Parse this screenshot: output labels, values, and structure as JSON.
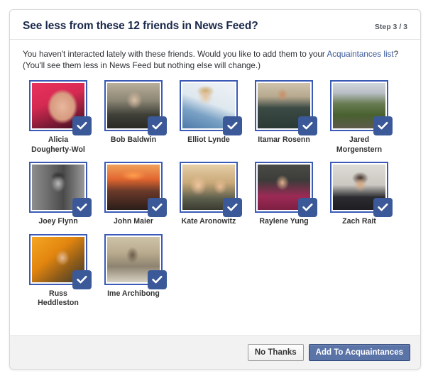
{
  "dialog": {
    "title": "See less from these 12 friends in News Feed?",
    "step": "Step 3 / 3",
    "intro_before": "You haven't interacted lately with these friends. Would you like to add them to your ",
    "intro_link": "Acquaintances list",
    "intro_after": "? (You'll see them less in News Feed but nothing else will change.)"
  },
  "friends": [
    {
      "name": "Alicia Dougherty-Wol",
      "selected": true,
      "photo": "ph-alicia"
    },
    {
      "name": "Bob Baldwin",
      "selected": true,
      "photo": "ph-bob"
    },
    {
      "name": "Elliot Lynde",
      "selected": true,
      "photo": "ph-elliot"
    },
    {
      "name": "Itamar Rosenn",
      "selected": true,
      "photo": "ph-itamar"
    },
    {
      "name": "Jared Morgenstern",
      "selected": true,
      "photo": "ph-jared"
    },
    {
      "name": "Joey Flynn",
      "selected": true,
      "photo": "ph-joey"
    },
    {
      "name": "John Maier",
      "selected": true,
      "photo": "ph-john"
    },
    {
      "name": "Kate Aronowitz",
      "selected": true,
      "photo": "ph-kate"
    },
    {
      "name": "Raylene Yung",
      "selected": true,
      "photo": "ph-raylene"
    },
    {
      "name": "Zach Rait",
      "selected": true,
      "photo": "ph-zach"
    },
    {
      "name": "Russ Heddleston",
      "selected": true,
      "photo": "ph-russ"
    },
    {
      "name": "Ime Archibong",
      "selected": true,
      "photo": "ph-ime"
    }
  ],
  "footer": {
    "secondary_label": "No Thanks",
    "primary_label": "Add To Acquaintances"
  },
  "icons": {
    "check": "check-icon"
  },
  "colors": {
    "brand_blue": "#3b5998",
    "primary_button": "#5b74a8",
    "tile_border": "#3b5ab5",
    "link": "#3b5998",
    "title": "#1b2a4b"
  }
}
